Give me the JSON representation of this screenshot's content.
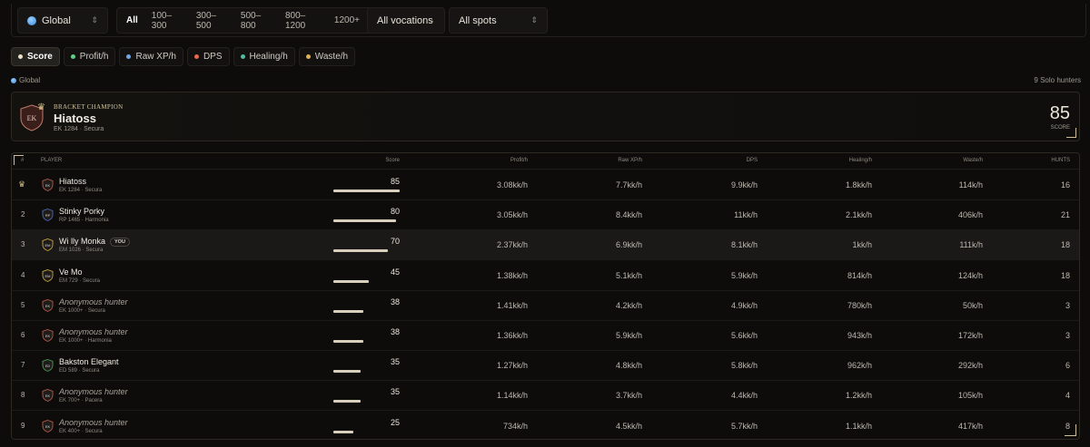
{
  "filters": {
    "region": "Global",
    "brackets": [
      "All",
      "100–300",
      "300–500",
      "500–800",
      "800–1200",
      "1200+"
    ],
    "vocation": "All vocations",
    "spot": "All spots"
  },
  "tabs": [
    {
      "label": "Score",
      "dot": "#e8e0c8"
    },
    {
      "label": "Profit/h",
      "dot": "#5fd08a"
    },
    {
      "label": "Raw XP/h",
      "dot": "#6fa8e8"
    },
    {
      "label": "DPS",
      "dot": "#e86a4a"
    },
    {
      "label": "Healing/h",
      "dot": "#4ac0a0"
    },
    {
      "label": "Waste/h",
      "dot": "#e0b050"
    }
  ],
  "meta": {
    "scope": "Global",
    "count": "9 Solo hunters"
  },
  "champion": {
    "label": "BRACKET CHAMPION",
    "name": "Hiatoss",
    "sub": "EK 1284 · Secura",
    "score": "85",
    "score_label": "SCORE",
    "crest": "EK"
  },
  "headers": {
    "rank": "#",
    "player": "PLAYER",
    "score": "Score",
    "profit": "Profit/h",
    "rawxp": "Raw XP/h",
    "dps": "DPS",
    "healing": "Healing/h",
    "waste": "Waste/h",
    "hunts": "HUNTS"
  },
  "rows": [
    {
      "rank": "",
      "crown": true,
      "voc": "EK",
      "color": "#b85a4a",
      "name": "Hiatoss",
      "sub": "EK 1284 · Secura",
      "anon": false,
      "you": false,
      "score": "85",
      "score_pct": 85,
      "profit": "3.08kk/h",
      "rawxp": "7.7kk/h",
      "dps": "9.9kk/h",
      "healing": "1.8kk/h",
      "waste": "114k/h",
      "hunts": "16"
    },
    {
      "rank": "2",
      "crown": false,
      "voc": "RP",
      "color": "#4a6ab8",
      "name": "Stinky Porky",
      "sub": "RP 1465 · Harmonia",
      "anon": false,
      "you": false,
      "score": "80",
      "score_pct": 80,
      "profit": "3.05kk/h",
      "rawxp": "8.4kk/h",
      "dps": "11kk/h",
      "healing": "2.1kk/h",
      "waste": "406k/h",
      "hunts": "21"
    },
    {
      "rank": "3",
      "crown": false,
      "voc": "EM",
      "color": "#c8a840",
      "name": "Wi lly Monka",
      "sub": "EM 1026 · Secura",
      "anon": false,
      "you": true,
      "you_label": "YOU",
      "score": "70",
      "score_pct": 70,
      "profit": "2.37kk/h",
      "rawxp": "6.9kk/h",
      "dps": "8.1kk/h",
      "healing": "1kk/h",
      "waste": "111k/h",
      "hunts": "18"
    },
    {
      "rank": "4",
      "crown": false,
      "voc": "EM",
      "color": "#c8a840",
      "name": "Ve Mo",
      "sub": "EM 729 · Secura",
      "anon": false,
      "you": false,
      "score": "45",
      "score_pct": 45,
      "profit": "1.38kk/h",
      "rawxp": "5.1kk/h",
      "dps": "5.9kk/h",
      "healing": "814k/h",
      "waste": "124k/h",
      "hunts": "18"
    },
    {
      "rank": "5",
      "crown": false,
      "voc": "EK",
      "color": "#b85a4a",
      "name": "Anonymous hunter",
      "sub": "EK 1000+ · Secura",
      "anon": true,
      "you": false,
      "score": "38",
      "score_pct": 38,
      "profit": "1.41kk/h",
      "rawxp": "4.2kk/h",
      "dps": "4.9kk/h",
      "healing": "780k/h",
      "waste": "50k/h",
      "hunts": "3"
    },
    {
      "rank": "6",
      "crown": false,
      "voc": "EK",
      "color": "#b85a4a",
      "name": "Anonymous hunter",
      "sub": "EK 1000+ · Harmonia",
      "anon": true,
      "you": false,
      "score": "38",
      "score_pct": 38,
      "profit": "1.36kk/h",
      "rawxp": "5.9kk/h",
      "dps": "5.6kk/h",
      "healing": "943k/h",
      "waste": "172k/h",
      "hunts": "3"
    },
    {
      "rank": "7",
      "crown": false,
      "voc": "ED",
      "color": "#4a9a5a",
      "name": "Bakston Elegant",
      "sub": "ED 589 · Secura",
      "anon": false,
      "you": false,
      "score": "35",
      "score_pct": 35,
      "profit": "1.27kk/h",
      "rawxp": "4.8kk/h",
      "dps": "5.8kk/h",
      "healing": "962k/h",
      "waste": "292k/h",
      "hunts": "6"
    },
    {
      "rank": "8",
      "crown": false,
      "voc": "EK",
      "color": "#b85a4a",
      "name": "Anonymous hunter",
      "sub": "EK 700+ · Pacera",
      "anon": true,
      "you": false,
      "score": "35",
      "score_pct": 35,
      "profit": "1.14kk/h",
      "rawxp": "3.7kk/h",
      "dps": "4.4kk/h",
      "healing": "1.2kk/h",
      "waste": "105k/h",
      "hunts": "4"
    },
    {
      "rank": "9",
      "crown": false,
      "voc": "EK",
      "color": "#b85a4a",
      "name": "Anonymous hunter",
      "sub": "EK 400+ · Secura",
      "anon": true,
      "you": false,
      "score": "25",
      "score_pct": 25,
      "profit": "734k/h",
      "rawxp": "4.5kk/h",
      "dps": "5.7kk/h",
      "healing": "1.1kk/h",
      "waste": "417k/h",
      "hunts": "8"
    }
  ],
  "icons": {
    "region": "globe-icon",
    "chevron": "chevron-updown-icon",
    "crown": "crown-icon"
  }
}
